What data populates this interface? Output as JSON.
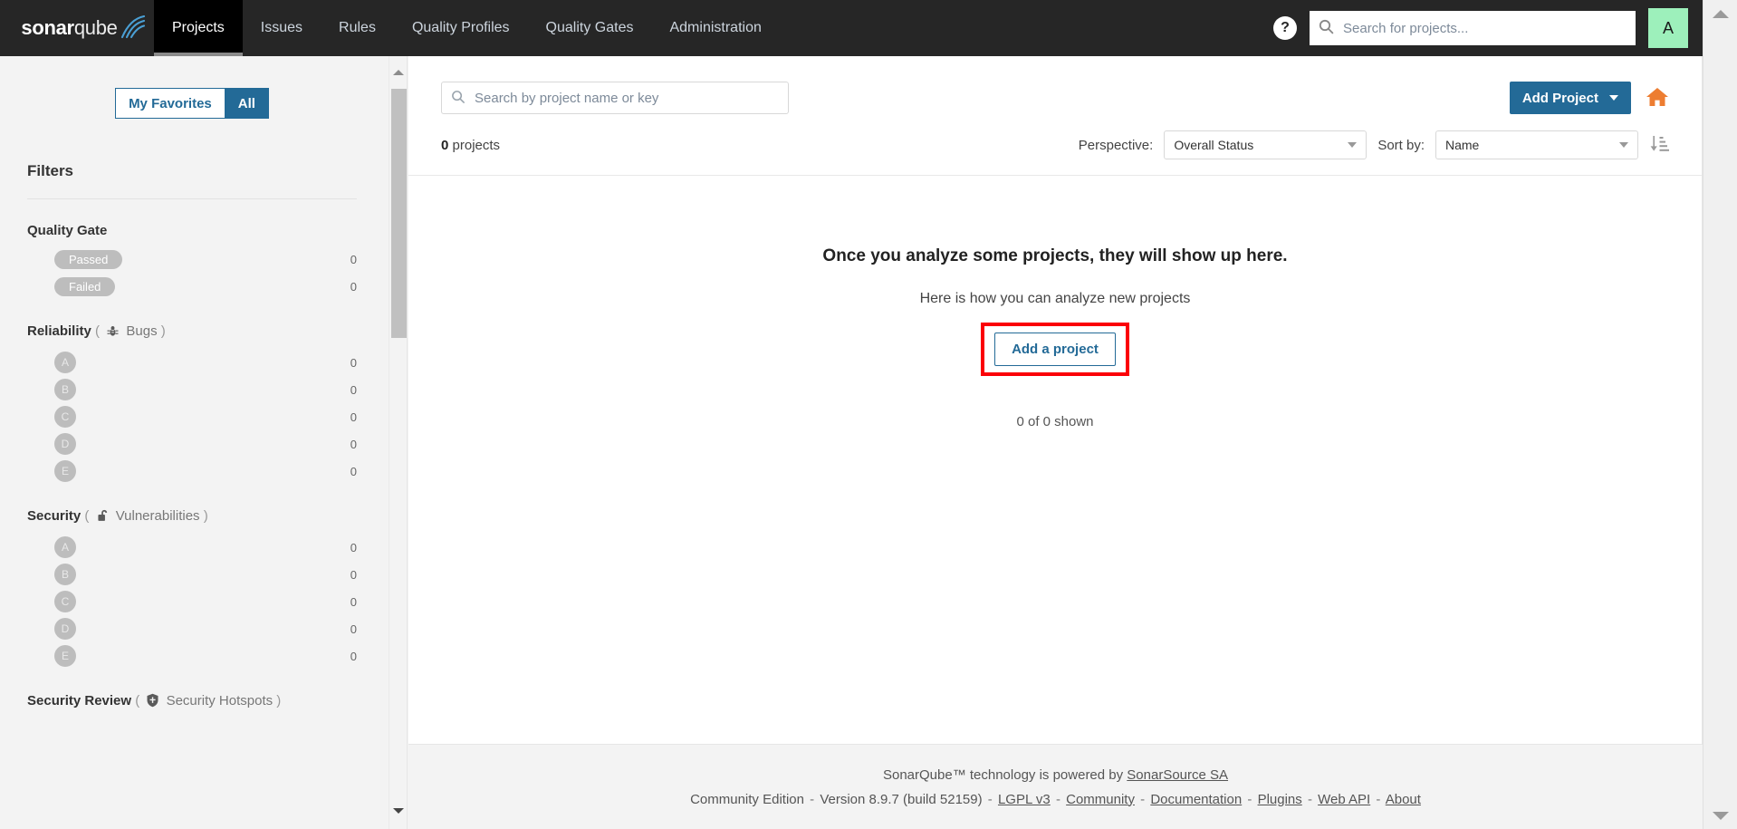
{
  "brand": {
    "logo_bold": "sonar",
    "logo_light": "qube",
    "accent_blue": "#236a97",
    "accent_orange": "#ed7d31",
    "navbar_bg": "#262626",
    "highlight_red": "#fb0007",
    "avatar_green": "#9df0bb"
  },
  "topnav": {
    "items": [
      {
        "label": "Projects",
        "active": true
      },
      {
        "label": "Issues",
        "active": false
      },
      {
        "label": "Rules",
        "active": false
      },
      {
        "label": "Quality Profiles",
        "active": false
      },
      {
        "label": "Quality Gates",
        "active": false
      },
      {
        "label": "Administration",
        "active": false
      }
    ],
    "help_glyph": "?",
    "search": {
      "value": "",
      "placeholder": "Search for projects..."
    },
    "avatar_initial": "A"
  },
  "sidebar": {
    "segmented": {
      "favorites_label": "My Favorites",
      "all_label": "All",
      "selected": "All"
    },
    "filters_title": "Filters",
    "facets": [
      {
        "title": "Quality Gate",
        "metric": "",
        "icon": "",
        "rows": [
          {
            "kind": "pill",
            "label": "Passed",
            "count": "0"
          },
          {
            "kind": "pill",
            "label": "Failed",
            "count": "0"
          }
        ]
      },
      {
        "title": "Reliability",
        "metric": "Bugs",
        "icon": "bug-icon",
        "rows": [
          {
            "kind": "grade",
            "label": "A",
            "count": "0"
          },
          {
            "kind": "grade",
            "label": "B",
            "count": "0"
          },
          {
            "kind": "grade",
            "label": "C",
            "count": "0"
          },
          {
            "kind": "grade",
            "label": "D",
            "count": "0"
          },
          {
            "kind": "grade",
            "label": "E",
            "count": "0"
          }
        ]
      },
      {
        "title": "Security",
        "metric": "Vulnerabilities",
        "icon": "unlock-icon",
        "rows": [
          {
            "kind": "grade",
            "label": "A",
            "count": "0"
          },
          {
            "kind": "grade",
            "label": "B",
            "count": "0"
          },
          {
            "kind": "grade",
            "label": "C",
            "count": "0"
          },
          {
            "kind": "grade",
            "label": "D",
            "count": "0"
          },
          {
            "kind": "grade",
            "label": "E",
            "count": "0"
          }
        ]
      },
      {
        "title": "Security Review",
        "metric": "Security Hotspots",
        "icon": "shield-icon",
        "rows": []
      }
    ],
    "paren_open": "(",
    "paren_close": ")"
  },
  "main": {
    "project_search": {
      "value": "",
      "placeholder": "Search by project name or key"
    },
    "add_project_button": "Add Project",
    "home_icon": "home-icon",
    "project_count_number": "0",
    "project_count_label": "projects",
    "perspective_label": "Perspective:",
    "perspective_value": "Overall Status",
    "sort_by_label": "Sort by:",
    "sort_by_value": "Name",
    "sort_direction_icon": "sort-ascending-icon",
    "empty_title": "Once you analyze some projects, they will show up here.",
    "empty_subtitle": "Here is how you can analyze new projects",
    "add_a_project_button": "Add a project",
    "shown_text": "0 of 0 shown"
  },
  "footer": {
    "line1_prefix": "SonarQube™ technology is powered by ",
    "line1_link": "SonarSource SA",
    "edition": "Community Edition",
    "version": "Version 8.9.7 (build 52159)",
    "links": [
      "LGPL v3",
      "Community",
      "Documentation",
      "Plugins",
      "Web API",
      "About"
    ],
    "separator": "-"
  }
}
